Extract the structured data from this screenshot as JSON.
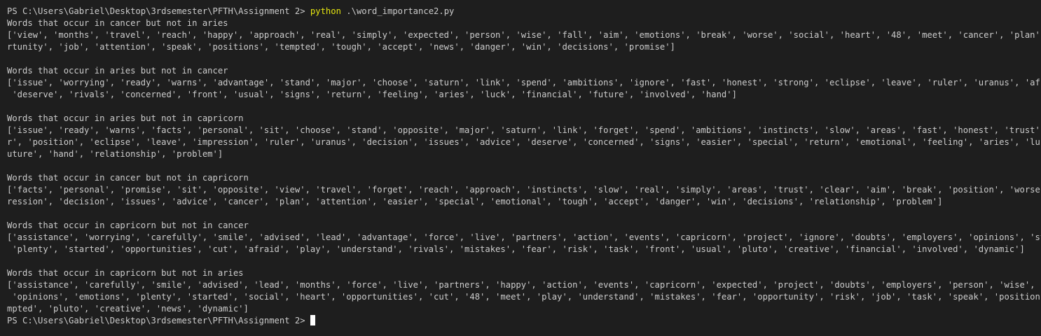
{
  "terminal": {
    "prompt": "PS C:\\Users\\Gabriel\\Desktop\\3rdsemester\\PFTH\\Assignment 2> ",
    "command": "python",
    "command_arg": " .\\word_importance2.py",
    "sections": [
      {
        "heading": "Words that occur in cancer but not in aries",
        "lines": [
          "['view', 'months', 'travel', 'reach', 'happy', 'approach', 'real', 'simply', 'expected', 'person', 'wise', 'fall', 'aim', 'emotions', 'break', 'worse', 'social', 'heart', '48', 'meet', 'cancer', 'plan', 'oppo",
          "rtunity', 'job', 'attention', 'speak', 'positions', 'tempted', 'tough', 'accept', 'news', 'danger', 'win', 'decisions', 'promise']"
        ]
      },
      {
        "heading": "Words that occur in aries but not in cancer",
        "lines": [
          "['issue', 'worrying', 'ready', 'warns', 'advantage', 'stand', 'major', 'choose', 'saturn', 'link', 'spend', 'ambitions', 'ignore', 'fast', 'honest', 'strong', 'eclipse', 'leave', 'ruler', 'uranus', 'afraid',",
          " 'deserve', 'rivals', 'concerned', 'front', 'usual', 'signs', 'return', 'feeling', 'aries', 'luck', 'financial', 'future', 'involved', 'hand']"
        ]
      },
      {
        "heading": "Words that occur in aries but not in capricorn",
        "lines": [
          "['issue', 'ready', 'warns', 'facts', 'personal', 'sit', 'choose', 'stand', 'opposite', 'major', 'saturn', 'link', 'forget', 'spend', 'ambitions', 'instincts', 'slow', 'areas', 'fast', 'honest', 'trust', 'clea",
          "r', 'position', 'eclipse', 'leave', 'impression', 'ruler', 'uranus', 'decision', 'issues', 'advice', 'deserve', 'concerned', 'signs', 'easier', 'special', 'return', 'emotional', 'feeling', 'aries', 'luck', 'f",
          "uture', 'hand', 'relationship', 'problem']"
        ]
      },
      {
        "heading": "Words that occur in cancer but not in capricorn",
        "lines": [
          "['facts', 'personal', 'promise', 'sit', 'opposite', 'view', 'travel', 'forget', 'reach', 'approach', 'instincts', 'slow', 'real', 'simply', 'areas', 'trust', 'clear', 'aim', 'break', 'position', 'worse', 'imp",
          "ression', 'decision', 'issues', 'advice', 'cancer', 'plan', 'attention', 'easier', 'special', 'emotional', 'tough', 'accept', 'danger', 'win', 'decisions', 'relationship', 'problem']"
        ]
      },
      {
        "heading": "Words that occur in capricorn but not in cancer",
        "lines": [
          "['assistance', 'worrying', 'carefully', 'smile', 'advised', 'lead', 'advantage', 'force', 'live', 'partners', 'action', 'events', 'capricorn', 'project', 'ignore', 'doubts', 'employers', 'opinions', 'strong',",
          " 'plenty', 'started', 'opportunities', 'cut', 'afraid', 'play', 'understand', 'rivals', 'mistakes', 'fear', 'risk', 'task', 'front', 'usual', 'pluto', 'creative', 'financial', 'involved', 'dynamic']"
        ]
      },
      {
        "heading": "Words that occur in capricorn but not in aries",
        "lines": [
          "['assistance', 'carefully', 'smile', 'advised', 'lead', 'months', 'force', 'live', 'partners', 'happy', 'action', 'events', 'capricorn', 'expected', 'project', 'doubts', 'employers', 'person', 'wise', 'fall',",
          " 'opinions', 'emotions', 'plenty', 'started', 'social', 'heart', 'opportunities', 'cut', '48', 'meet', 'play', 'understand', 'mistakes', 'fear', 'opportunity', 'risk', 'job', 'task', 'speak', 'positions', 'te",
          "mpted', 'pluto', 'creative', 'news', 'dynamic']"
        ]
      }
    ],
    "final_prompt": "PS C:\\Users\\Gabriel\\Desktop\\3rdsemester\\PFTH\\Assignment 2> "
  }
}
